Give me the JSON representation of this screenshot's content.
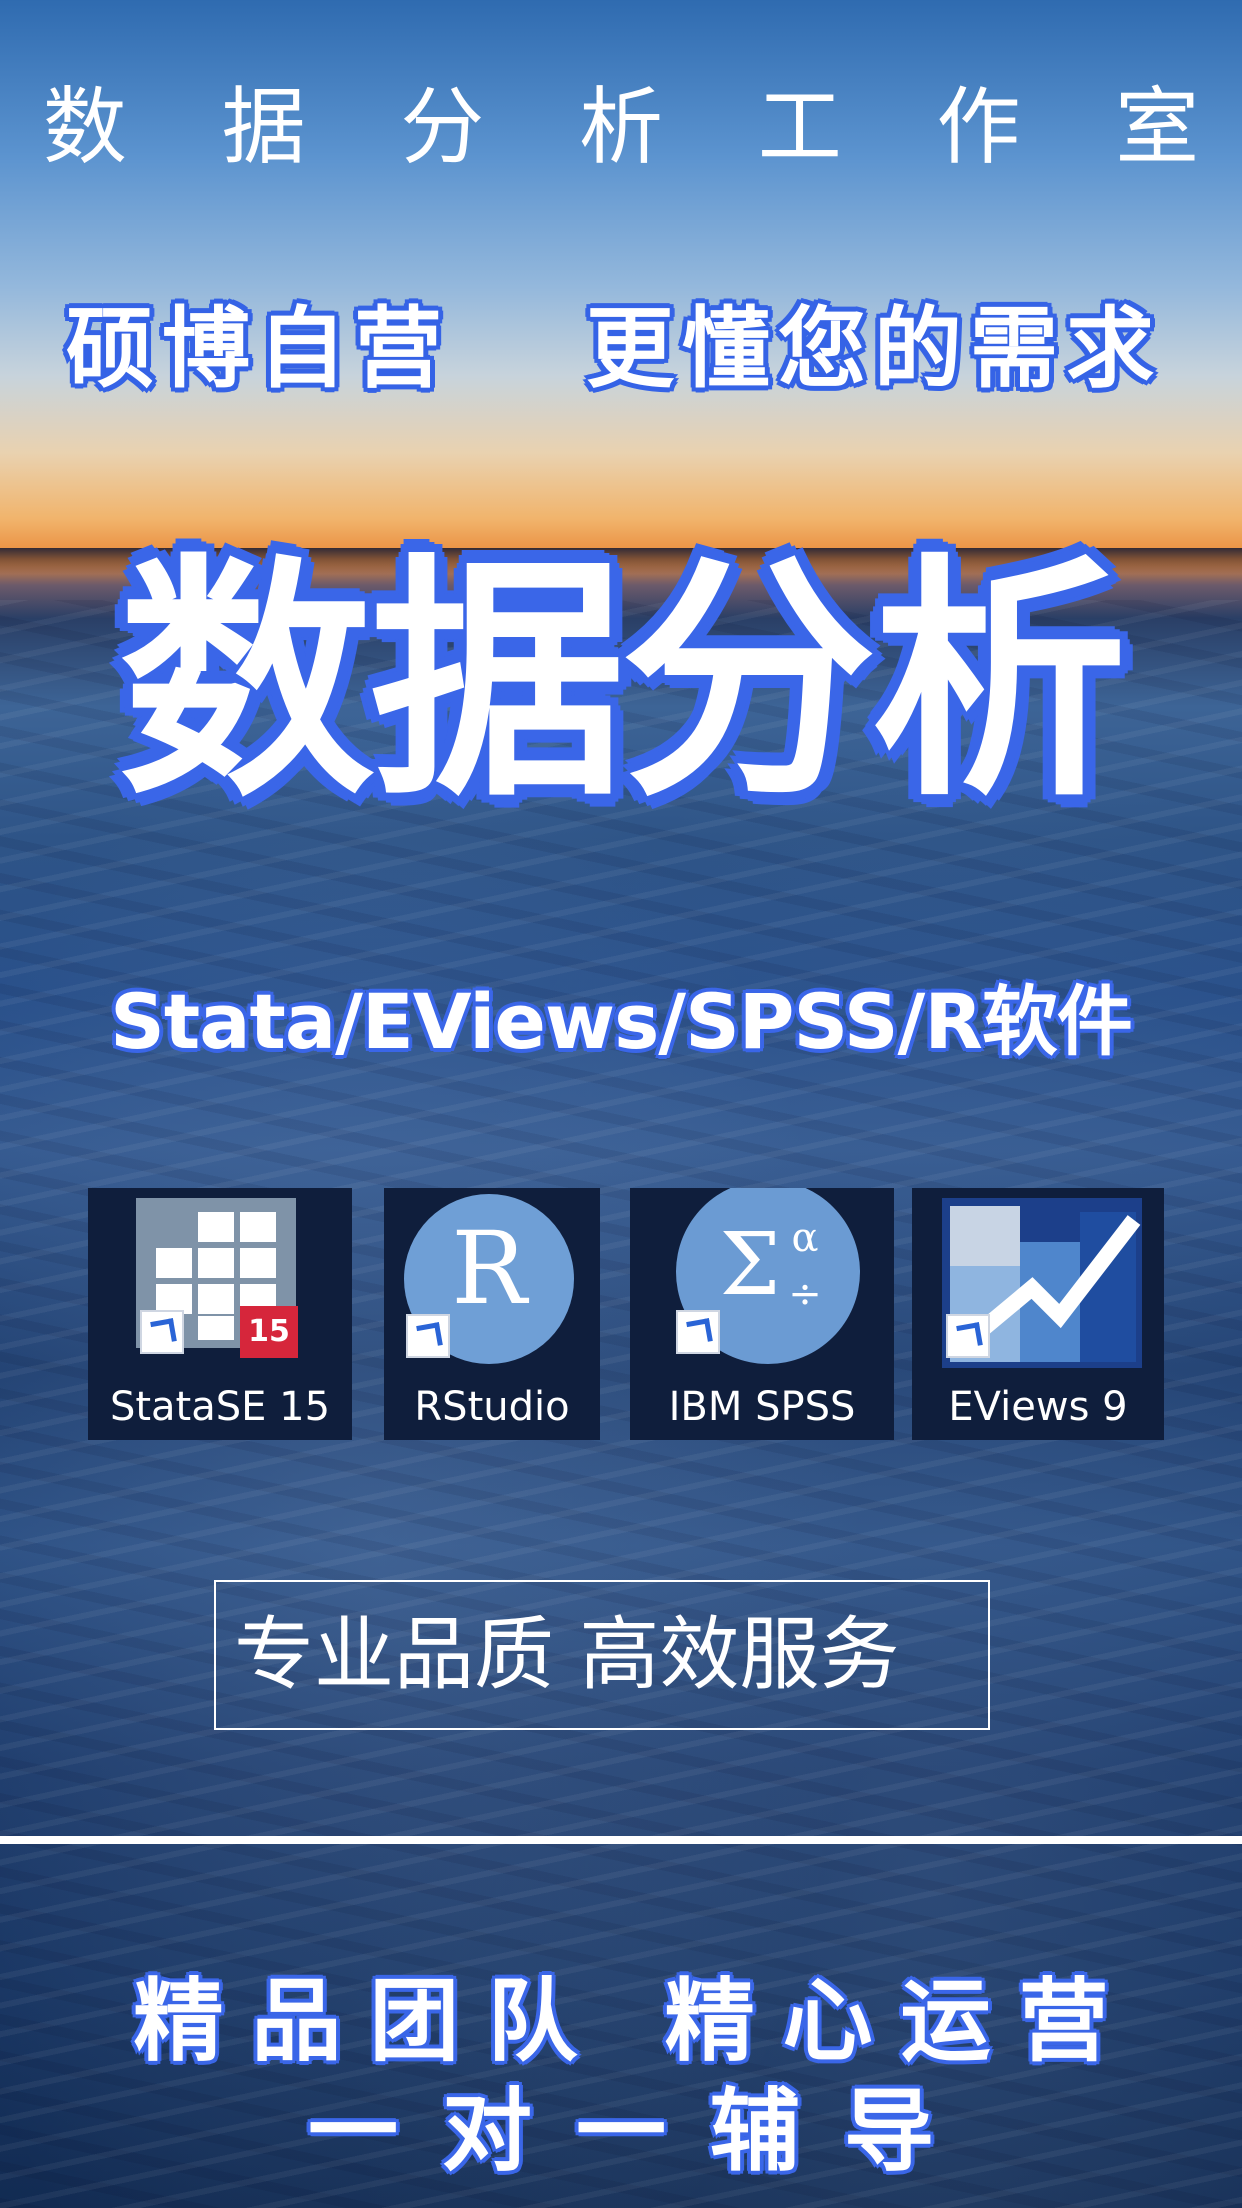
{
  "header": {
    "studio_title": "数 据 分 析 工 作 室"
  },
  "slogans": {
    "left": "硕博自营",
    "right": "更懂您的需求"
  },
  "main": {
    "title": "数据分析",
    "software_line": "Stata/EViews/SPSS/R软件"
  },
  "software_icons": [
    {
      "label": "StataSE 15",
      "icon": "stata-icon",
      "badge": "15"
    },
    {
      "label": "RStudio",
      "icon": "rstudio-icon",
      "glyph": "R"
    },
    {
      "label": "IBM SPSS",
      "icon": "spss-icon",
      "glyph": "Σ",
      "glyph2": "α",
      "glyph3": "÷"
    },
    {
      "label": "EViews 9",
      "icon": "eviews-icon"
    }
  ],
  "tagline": {
    "text": "专业品质    高效服务"
  },
  "footer": {
    "line1": "精品团队  精心运营",
    "line2": "一对一辅导"
  },
  "colors": {
    "accent_blue": "#3a66e8",
    "stata_red": "#d6263b"
  }
}
